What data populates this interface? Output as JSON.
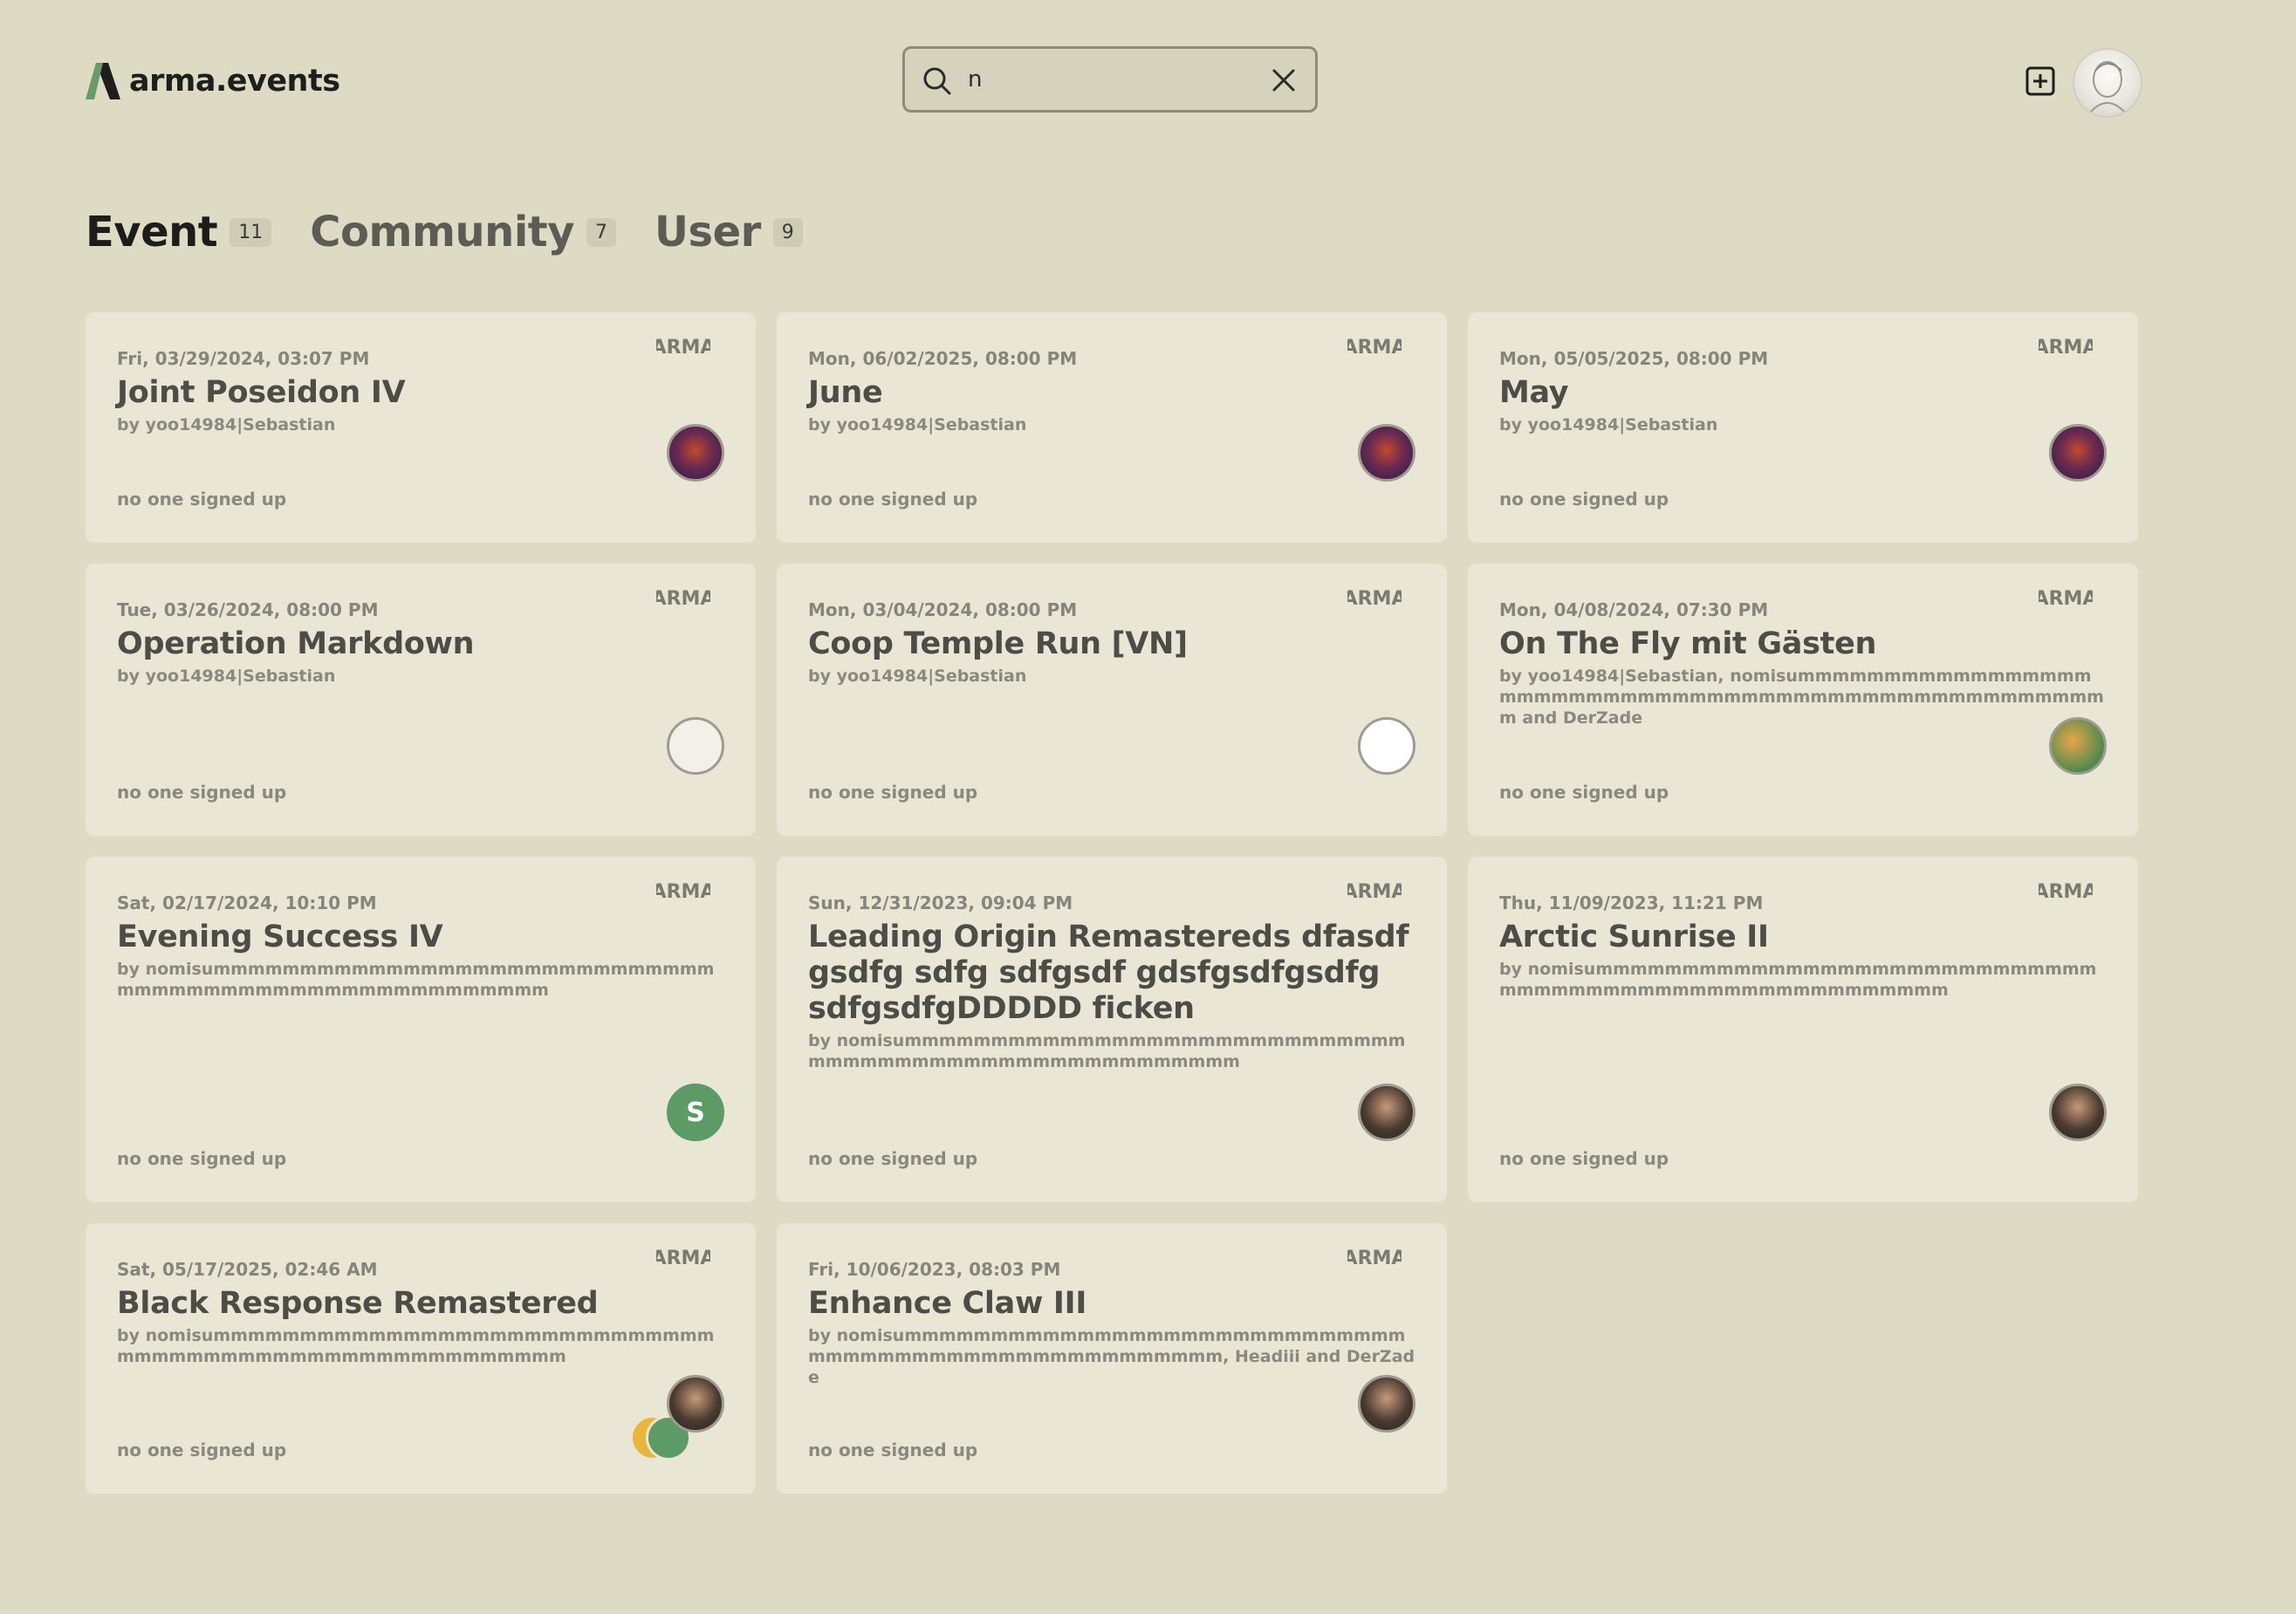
{
  "app": {
    "name": "arma.events",
    "colors": {
      "background": "#dedbc4",
      "card": "#e9e6d6",
      "logo_green": "#6b9a6a",
      "logo_dark": "#1e1e1c"
    }
  },
  "search": {
    "value": "n",
    "placeholder": ""
  },
  "tabs": [
    {
      "label": "Event",
      "count": "11",
      "active": true
    },
    {
      "label": "Community",
      "count": "7",
      "active": false
    },
    {
      "label": "User",
      "count": "9",
      "active": false
    }
  ],
  "icons": {
    "search": "search-icon",
    "clear": "close-icon",
    "add": "plus-square-icon",
    "game": "arma-game-icon"
  },
  "events": [
    {
      "date": "Fri, 03/29/2024, 03:07 PM",
      "title": "Joint Poseidon IV",
      "by": "by yoo14984|Sebastian",
      "signed": "no one signed up",
      "avatar": "buddies"
    },
    {
      "date": "Mon, 06/02/2025, 08:00 PM",
      "title": "June",
      "by": "by yoo14984|Sebastian",
      "signed": "no one signed up",
      "avatar": "buddies"
    },
    {
      "date": "Mon, 05/05/2025, 08:00 PM",
      "title": "May",
      "by": "by yoo14984|Sebastian",
      "signed": "no one signed up",
      "avatar": "buddies"
    },
    {
      "date": "Tue, 03/26/2024, 08:00 PM",
      "title": "Operation Markdown",
      "by": "by yoo14984|Sebastian",
      "signed": "no one signed up",
      "avatar": "bird"
    },
    {
      "date": "Mon, 03/04/2024, 08:00 PM",
      "title": "Coop Temple Run [VN]",
      "by": "by yoo14984|Sebastian",
      "signed": "no one signed up",
      "avatar": "face"
    },
    {
      "date": "Mon, 04/08/2024, 07:30 PM",
      "title": "On The Fly mit Gästen",
      "by": "by yoo14984|Sebastian, nomisummmmmmmmmmmmmmmmmmmmmmmmmmmmmmmmmmmmmmmmmmmmmmmmmmmmm and DerZade",
      "signed": "no one signed up",
      "avatar": "green"
    },
    {
      "date": "Sat, 02/17/2024, 10:10 PM",
      "title": "Evening Success IV",
      "by": "by nomisummmmmmmmmmmmmmmmmmmmmmmmmmmmmmmmmmmmmmmmmmmmmmmmmmmmmm",
      "signed": "no one signed up",
      "avatar": "S"
    },
    {
      "date": "Sun, 12/31/2023, 09:04 PM",
      "title": "Leading Origin Remastereds dfasdf gsdfg sdfg sdfgsdf gdsfgsdfgsdfg sdfgsdfgDDDDD ficken",
      "by": "by nomisummmmmmmmmmmmmmmmmmmmmmmmmmmmmmmmmmmmmmmmmmmmmmmmmmmmmm",
      "signed": "no one signed up",
      "avatar": "photo"
    },
    {
      "date": "Thu, 11/09/2023, 11:21 PM",
      "title": "Arctic Sunrise II",
      "by": "by nomisummmmmmmmmmmmmmmmmmmmmmmmmmmmmmmmmmmmmmmmmmmmmmmmmmmmmmm",
      "signed": "no one signed up",
      "avatar": "photo"
    },
    {
      "date": "Sat, 05/17/2025, 02:46 AM",
      "title": "Black Response Remastered",
      "by": "by nomisummmmmmmmmmmmmmmmmmmmmmmmmmmmmmmmmmmmmmmmmmmmmmmmmmmmmmm",
      "signed": "no one signed up",
      "avatar": "photo",
      "extra_avatars": true
    },
    {
      "date": "Fri, 10/06/2023, 08:03 PM",
      "title": "Enhance Claw III",
      "by": "by nomisummmmmmmmmmmmmmmmmmmmmmmmmmmmmmmmmmmmmmmmmmmmmmmmmmmmm, Headiii and DerZade",
      "signed": "no one signed up",
      "avatar": "photo"
    }
  ]
}
